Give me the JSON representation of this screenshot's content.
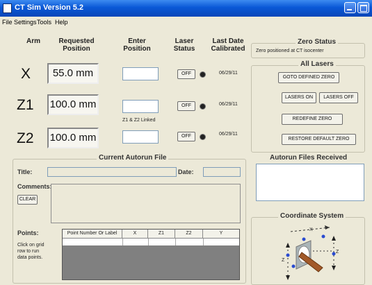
{
  "window": {
    "title": "CT Sim Version 5.2"
  },
  "menu": [
    "File",
    "Settings",
    "Tools",
    "Help"
  ],
  "headers": {
    "arm": "Arm",
    "requested": "Requested\nPosition",
    "enter": "Enter\nPosition",
    "laser": "Laser\nStatus",
    "last_date": "Last Date\nCalibrated"
  },
  "axes": [
    {
      "name": "X",
      "requested": "55.0 mm",
      "laser": "OFF",
      "date": "06/29/11"
    },
    {
      "name": "Z1",
      "requested": "100.0 mm",
      "laser": "OFF",
      "date": "06/29/11"
    },
    {
      "name": "Z2",
      "requested": "100.0 mm",
      "laser": "OFF",
      "date": "06/29/11"
    }
  ],
  "linked_note": "Z1 & Z2 Linked",
  "zero_status": {
    "title": "Zero Status",
    "text": "Zero positioned at CT isocenter"
  },
  "all_lasers": {
    "title": "All Lasers",
    "goto": "GOTO DEFINED ZERO",
    "on": "LASERS ON",
    "off": "LASERS OFF",
    "redefine": "REDEFINE ZERO",
    "restore": "RESTORE DEFAULT ZERO"
  },
  "autorun": {
    "title": "Current Autorun File",
    "title_label": "Title:",
    "date_label": "Date:",
    "comments_label": "Comments:",
    "clear": "CLEAR",
    "points_label": "Points:",
    "hint": "Click on grid row to run data points.",
    "columns": [
      "Point Number Or Label",
      "X",
      "Z1",
      "Z2",
      "Y"
    ]
  },
  "received": {
    "title": "Autorun Files Received"
  },
  "coord": {
    "title": "Coordinate System",
    "labels": {
      "x": "X",
      "z_left": "Z",
      "z_right": "Z"
    }
  },
  "colors": {
    "titlebar": "#0a58d6",
    "face": "#ece9d8",
    "grid_empty": "#808080"
  }
}
